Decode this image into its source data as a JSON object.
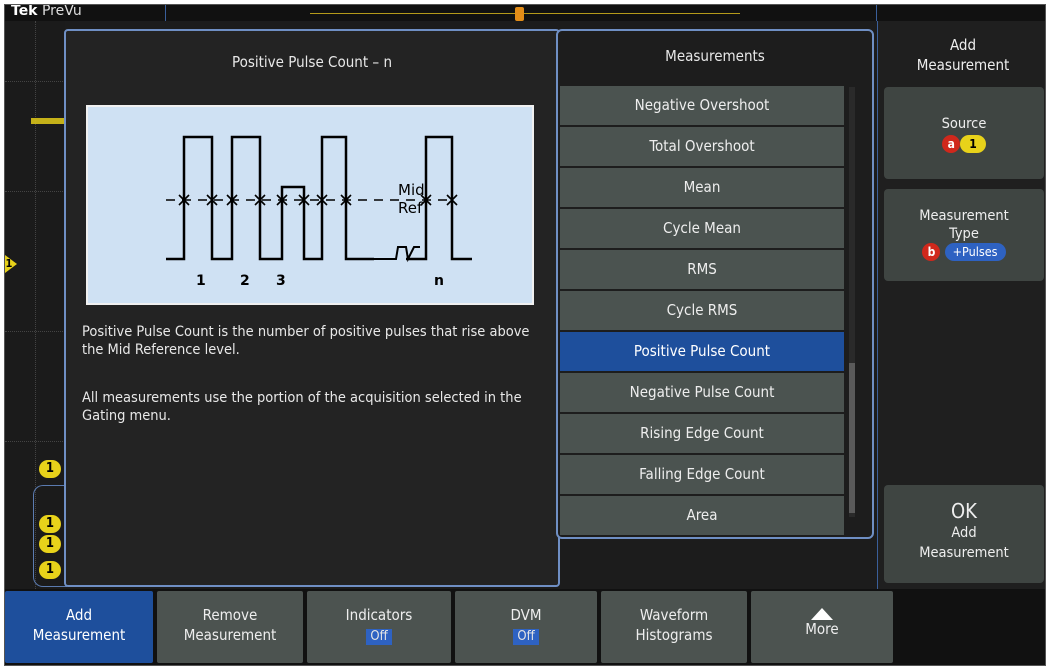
{
  "brand": {
    "logo_bold": "Tek",
    "mode": "PreVu"
  },
  "help": {
    "title": "Positive Pulse Count – n",
    "mid_ref_label_1": "Mid",
    "mid_ref_label_2": "Ref",
    "pulse_labels": [
      "1",
      "2",
      "3",
      "n"
    ],
    "description": "Positive Pulse Count is the number of positive pulses that rise above the Mid Reference level.",
    "gating_note": "All measurements use the portion of the acquisition selected in the Gating menu."
  },
  "measurements": {
    "title": "Measurements",
    "items": [
      "Negative Overshoot",
      "Total Overshoot",
      "Mean",
      "Cycle Mean",
      "RMS",
      "Cycle RMS",
      "Positive Pulse Count",
      "Negative Pulse Count",
      "Rising Edge Count",
      "Falling Edge Count",
      "Area"
    ],
    "selected": "Positive Pulse Count"
  },
  "side_menu": {
    "title_1": "Add",
    "title_2": "Measurement",
    "source": {
      "label": "Source",
      "knob": "a",
      "channel": "1"
    },
    "type": {
      "label_1": "Measurement",
      "label_2": "Type",
      "knob": "b",
      "value": "+Pulses"
    },
    "ok": {
      "label_1": "OK",
      "label_2": "Add",
      "label_3": "Measurement"
    }
  },
  "channel_badges": [
    "1",
    "1",
    "1",
    "1",
    "1"
  ],
  "bottom_menu": {
    "add": {
      "l1": "Add",
      "l2": "Measurement"
    },
    "remove": {
      "l1": "Remove",
      "l2": "Measurement"
    },
    "indicators": {
      "l1": "Indicators",
      "l2": "Off"
    },
    "dvm": {
      "l1": "DVM",
      "l2": "Off"
    },
    "histograms": {
      "l1": "Waveform",
      "l2": "Histograms"
    },
    "more": {
      "l1": "More"
    }
  }
}
